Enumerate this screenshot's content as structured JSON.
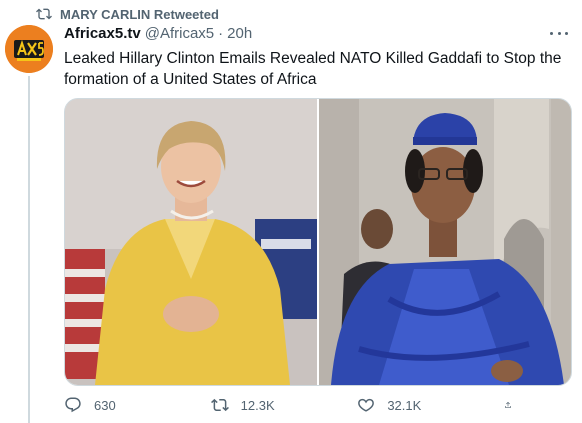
{
  "retweet": {
    "label": "MARY CARLIN Retweeted",
    "icon": "retweet-icon"
  },
  "author": {
    "display_name": "Africax5.tv",
    "handle": "@Africax5",
    "separator": "·",
    "time": "20h",
    "avatar_icon": "africax5-logo",
    "avatar_color": "#ec7f1f"
  },
  "tweet": {
    "text": "Leaked Hillary Clinton Emails Revealed NATO Killed Gaddafi to Stop the formation of a United States of Africa"
  },
  "media": {
    "images": [
      {
        "name": "photo-woman-yellow-suit"
      },
      {
        "name": "photo-man-blue-robe"
      }
    ]
  },
  "actions": {
    "reply_count": "630",
    "retweet_count": "12.3K",
    "like_count": "32.1K",
    "icons": [
      "reply-icon",
      "retweet-icon",
      "like-icon",
      "share-icon"
    ]
  },
  "colors": {
    "text": "#0f1419",
    "secondary": "#536471",
    "border": "#cfd9de"
  }
}
